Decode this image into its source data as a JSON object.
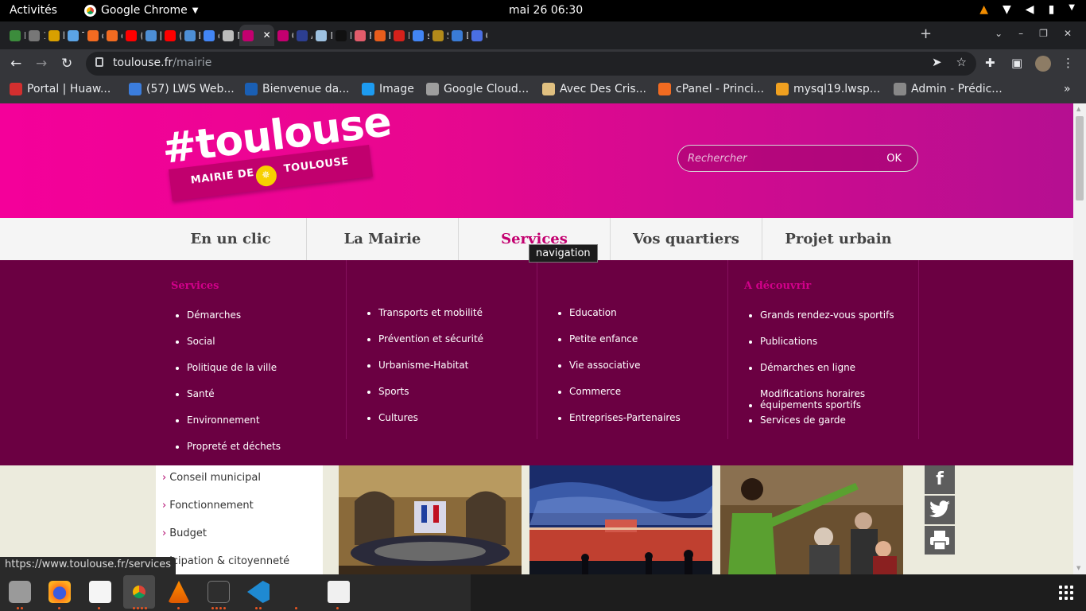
{
  "system": {
    "activities": "Activités",
    "app_name": "Google Chrome",
    "clock": "mai 26  06:30"
  },
  "tabs": [
    {
      "title": "H",
      "color": "#3c8c3c"
    },
    {
      "title": "1",
      "color": "#777777"
    },
    {
      "title": "lc",
      "color": "#d9a000"
    },
    {
      "title": "T",
      "color": "#5ba4e6"
    },
    {
      "title": "cl",
      "color": "#f26b21"
    },
    {
      "title": "cl",
      "color": "#f26b21"
    },
    {
      "title": "(",
      "color": "#ff0000"
    },
    {
      "title": "[(",
      "color": "#4d8fd6"
    },
    {
      "title": "(",
      "color": "#ff0000"
    },
    {
      "title": "B",
      "color": "#4d8fd6"
    },
    {
      "title": "c",
      "color": "#4285f4"
    },
    {
      "title": "M",
      "color": "#bbbbbb"
    },
    {
      "title": "",
      "color": "#c3006f",
      "active": true
    },
    {
      "title": "C",
      "color": "#c3006f"
    },
    {
      "title": "A",
      "color": "#2c3e90"
    },
    {
      "title": "M",
      "color": "#9dc1e0"
    },
    {
      "title": "D",
      "color": "#111111"
    },
    {
      "title": "F",
      "color": "#e25c6b"
    },
    {
      "title": "D",
      "color": "#e85d1c"
    },
    {
      "title": "D",
      "color": "#d4211b"
    },
    {
      "title": "s",
      "color": "#4285f4"
    },
    {
      "title": "S",
      "color": "#b28a1a"
    },
    {
      "title": "D",
      "color": "#3a7bd5"
    },
    {
      "title": "C",
      "color": "#4a6fe3"
    }
  ],
  "tab_close": "✕",
  "new_tab": "+",
  "address": {
    "host": "toulouse.fr",
    "path": "/mairie"
  },
  "bookmarks": [
    {
      "label": "Portal | Huaw...",
      "color": "#d32f2f"
    },
    {
      "label": "(57) LWS Web...",
      "color": "#3b7ddd"
    },
    {
      "label": "Bienvenue da...",
      "color": "#1a5fb4"
    },
    {
      "label": "Image",
      "color": "#1d9bf0"
    },
    {
      "label": "Google Cloud...",
      "color": "#9e9e9e"
    },
    {
      "label": "Avec Des Cris...",
      "color": "#e0c080"
    },
    {
      "label": "cPanel - Princi...",
      "color": "#f26b21"
    },
    {
      "label": "mysql19.lwsp...",
      "color": "#f0a020"
    },
    {
      "label": "Admin - Prédic...",
      "color": "#888888"
    }
  ],
  "bookmarks_more": "»",
  "site": {
    "logo_hash": "#toulouse",
    "logo_band_left": "MAIRIE DE",
    "logo_band_right": "TOULOUSE",
    "search_placeholder": "Rechercher",
    "search_ok": "OK",
    "nav": [
      "En un clic",
      "La Mairie",
      "Services",
      "Vos quartiers",
      "Projet urbain"
    ],
    "nav_active": "Services",
    "tooltip": "navigation",
    "menu": {
      "col1": {
        "heading": "Services",
        "items": [
          "Démarches",
          "Social",
          "Politique de la ville",
          "Santé",
          "Environnement",
          "Propreté et déchets"
        ]
      },
      "col2": {
        "items": [
          "Transports et mobilité",
          "Prévention et sécurité",
          "Urbanisme-Habitat",
          "Sports",
          "Cultures"
        ]
      },
      "col3": {
        "items": [
          "Education",
          "Petite enfance",
          "Vie associative",
          "Commerce",
          "Entreprises-Partenaires"
        ]
      },
      "col4": {
        "heading": "A découvrir",
        "items": [
          "Grands rendez-vous sportifs",
          "Publications",
          "Démarches en ligne",
          "Modifications horaires équipements sportifs",
          "Services de garde"
        ]
      }
    },
    "side_menu": [
      "Conseil municipal",
      "Fonctionnement",
      "Budget",
      "icipation & citoyenneté"
    ],
    "social": {
      "facebook": "f",
      "twitter": "twitter-icon",
      "print": "print-icon"
    }
  },
  "status_url": "https://www.toulouse.fr/services"
}
